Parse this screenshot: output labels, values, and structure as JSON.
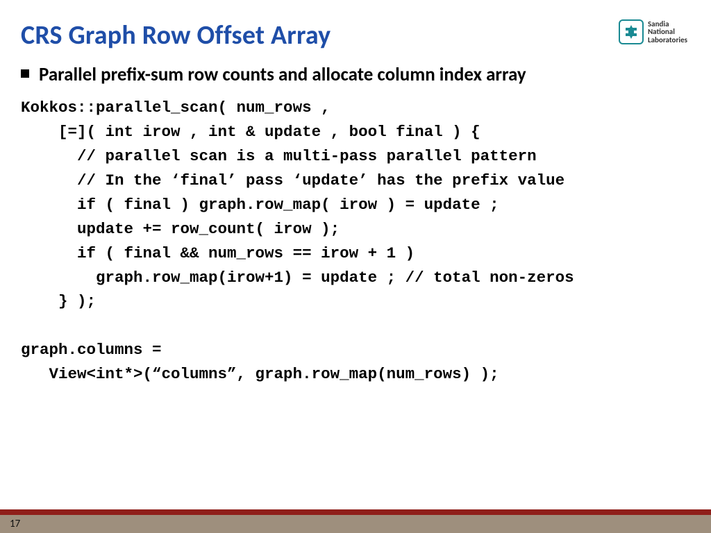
{
  "title": "CRS Graph Row Offset Array",
  "logo": {
    "line1": "Sandia",
    "line2": "National",
    "line3": "Laboratories"
  },
  "bullet": "Parallel prefix-sum row counts and allocate column index array",
  "code": "Kokkos::parallel_scan( num_rows ,\n    [=]( int irow , int & update , bool final ) {\n      // parallel scan is a multi-pass parallel pattern\n      // In the ‘final’ pass ‘update’ has the prefix value\n      if ( final ) graph.row_map( irow ) = update ;\n      update += row_count( irow );\n      if ( final && num_rows == irow + 1 )\n        graph.row_map(irow+1) = update ; // total non-zeros\n    } );\n\ngraph.columns =\n   View<int*>(“columns”, graph.row_map(num_rows) );",
  "page_number": "17"
}
